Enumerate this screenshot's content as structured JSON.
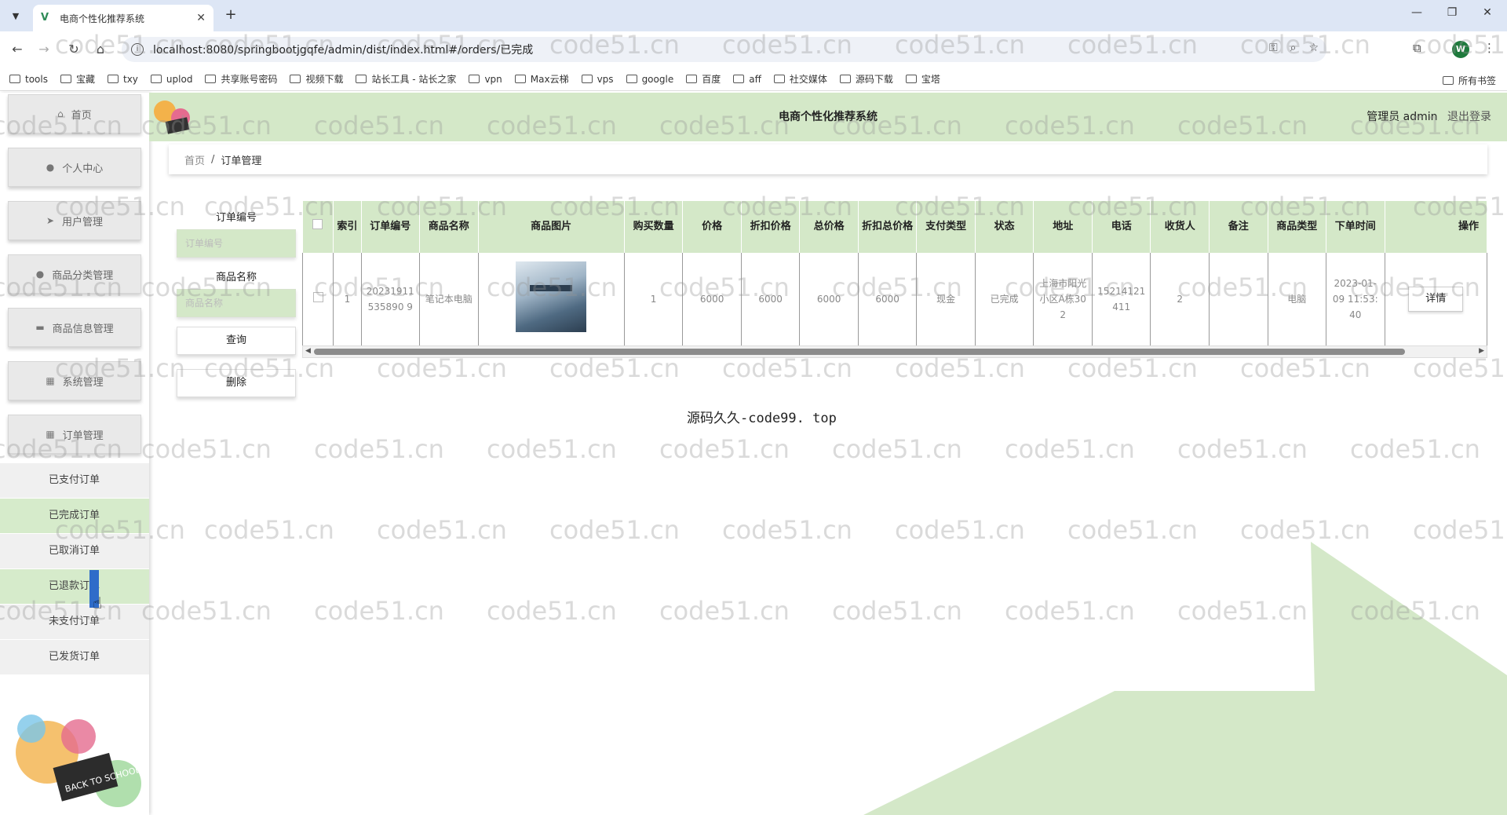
{
  "browser": {
    "tab_title": "电商个性化推荐系统",
    "url": "localhost:8080/springbootjgqfe/admin/dist/index.html#/orders/已完成",
    "profile_initial": "W",
    "bookmarks": [
      "tools",
      "宝藏",
      "txy",
      "uplod",
      "共享账号密码",
      "视频下载",
      "站长工具 - 站长之家",
      "vpn",
      "Max云梯",
      "vps",
      "google",
      "百度",
      "aff",
      "社交媒体",
      "源码下载",
      "宝塔"
    ],
    "bookmarks_all": "所有书签"
  },
  "sidebar": {
    "menu": [
      {
        "label": "首页",
        "icon": "home-icon"
      },
      {
        "label": "个人中心",
        "icon": "user-icon"
      },
      {
        "label": "用户管理",
        "icon": "send-icon"
      },
      {
        "label": "商品分类管理",
        "icon": "user-icon"
      },
      {
        "label": "商品信息管理",
        "icon": "stack-icon"
      },
      {
        "label": "系统管理",
        "icon": "grid-icon"
      },
      {
        "label": "订单管理",
        "icon": "grid-icon"
      }
    ],
    "submenu": [
      {
        "label": "已支付订单",
        "active": false
      },
      {
        "label": "已完成订单",
        "active": true
      },
      {
        "label": "已取消订单",
        "active": false
      },
      {
        "label": "已退款订单",
        "active": true
      },
      {
        "label": "未支付订单",
        "active": false
      },
      {
        "label": "已发货订单",
        "active": false
      }
    ],
    "school_badge": "BACK TO SCHOOL"
  },
  "header": {
    "title": "电商个性化推荐系统",
    "user": "管理员 admin",
    "logout": "退出登录"
  },
  "breadcrumb": {
    "home": "首页",
    "separator": "/",
    "current": "订单管理"
  },
  "search": {
    "order_no_label": "订单编号",
    "order_no_placeholder": "订单编号",
    "product_name_label": "商品名称",
    "product_name_placeholder": "商品名称",
    "query_button": "查询",
    "delete_button": "删除"
  },
  "table": {
    "headers": [
      "索引",
      "订单编号",
      "商品名称",
      "商品图片",
      "购买数量",
      "价格",
      "折扣价格",
      "总价格",
      "折扣总价格",
      "支付类型",
      "状态",
      "地址",
      "电话",
      "收货人",
      "备注",
      "商品类型",
      "下单时间",
      "操作"
    ],
    "rows": [
      {
        "index": "1",
        "order_no": "20231911535890 9",
        "product_name": "笔记本电脑",
        "quantity": "1",
        "price": "6000",
        "discount_price": "6000",
        "total": "6000",
        "discount_total": "6000",
        "pay_type": "现金",
        "status": "已完成",
        "address": "上海市阳光小区A栋302",
        "phone": "15214121411",
        "receiver": "2",
        "remark": "",
        "category": "电脑",
        "order_time": "2023-01-09 11:53:40",
        "action": "详情"
      }
    ]
  },
  "footer_text": "源码久久-code99. top",
  "watermark": "code51.cn",
  "colors": {
    "accent_green": "#d4e8c8",
    "menu_grey": "#e9e9e9",
    "cursor_blue": "#2f6cc9"
  }
}
